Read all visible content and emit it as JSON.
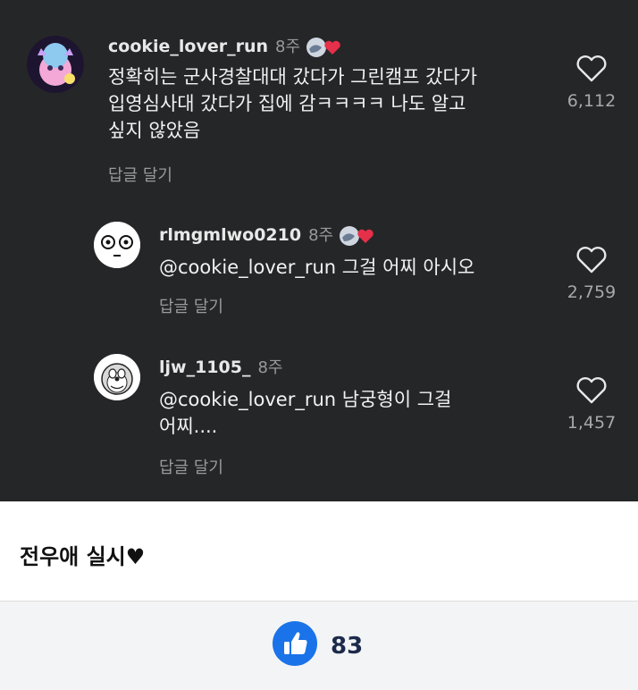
{
  "comments": [
    {
      "username": "cookie_lover_run",
      "age": "8주",
      "text_lines": [
        "정확히는 군사경찰대대 갔다가 그린캠프 갔다가",
        "입영심사대 갔다가 집에 감ㅋㅋㅋㅋ 나도 알고",
        "싶지 않았음"
      ],
      "reply_label": "답글 달기",
      "likes": "6,112"
    },
    {
      "username": "rlmgmlwo0210",
      "age": "8주",
      "text_lines": [
        "@cookie_lover_run 그걸 어찌 아시오"
      ],
      "reply_label": "답글 달기",
      "likes": "2,759"
    },
    {
      "username": "ljw_1105_",
      "age": "8주",
      "text_lines": [
        "@cookie_lover_run 남궁형이 그걸",
        "어찌...."
      ],
      "reply_label": "답글 달기",
      "likes": "1,457"
    }
  ],
  "caption": "전우애 실시♥",
  "footer": {
    "like_count": "83"
  },
  "colors": {
    "background_dark": "#252628",
    "like_blue": "#1a73e8",
    "author_like_heart": "#e5304a"
  },
  "icons": [
    "heart-outline-icon",
    "thumbs-up-icon",
    "creator-liked-icon"
  ]
}
